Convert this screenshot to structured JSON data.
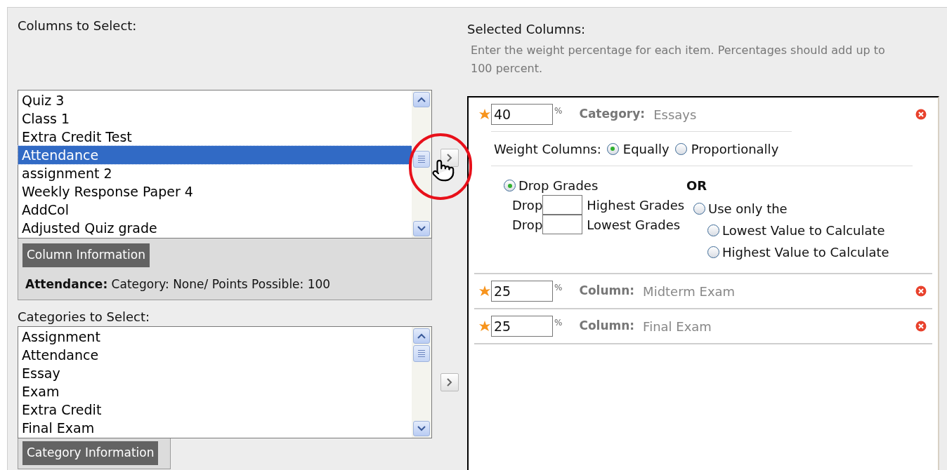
{
  "columns_to_select": {
    "label": "Columns to Select:",
    "items": [
      {
        "label": "Quiz 3",
        "selected": false
      },
      {
        "label": "Class 1",
        "selected": false
      },
      {
        "label": "Extra Credit Test",
        "selected": false
      },
      {
        "label": "Attendance",
        "selected": true
      },
      {
        "label": "assignment 2",
        "selected": false
      },
      {
        "label": "Weekly Response Paper 4",
        "selected": false
      },
      {
        "label": "AddCol",
        "selected": false
      },
      {
        "label": "Adjusted Quiz grade",
        "selected": false
      }
    ],
    "info_button": "Column Information",
    "info": "**Attendance:** Category: None/ Points Possible: 100"
  },
  "categories_to_select": {
    "label": "Categories to Select:",
    "items": [
      {
        "label": "Assignment",
        "selected": false
      },
      {
        "label": "Attendance",
        "selected": false
      },
      {
        "label": "Essay",
        "selected": false
      },
      {
        "label": "Exam",
        "selected": false
      },
      {
        "label": "Extra Credit",
        "selected": false
      },
      {
        "label": "Final Exam",
        "selected": false
      }
    ],
    "info_button": "Category Information"
  },
  "selected_columns": {
    "label": "Selected Columns:",
    "hint": "Enter the weight percentage for each item. Percentages should add up to 100 percent.",
    "entries": [
      {
        "weight": "40",
        "unit": "%",
        "type_label": "Category:",
        "name": "Essays",
        "weight_columns": {
          "label": "Weight Columns:",
          "options": [
            {
              "label": "Equally",
              "selected": true
            },
            {
              "label": "Proportionally",
              "selected": false
            }
          ]
        },
        "drop_grades": {
          "label": "Drop Grades",
          "selected": true,
          "rows": [
            {
              "prefix": "Drop",
              "suffix": "Highest Grades"
            },
            {
              "prefix": "Drop",
              "suffix": "Lowest Grades"
            }
          ],
          "or": "OR",
          "use_only": {
            "label": "Use only the",
            "selected": false,
            "options": [
              {
                "label": "Lowest Value to Calculate",
                "selected": false
              },
              {
                "label": "Highest Value to Calculate",
                "selected": false
              }
            ]
          }
        }
      },
      {
        "weight": "25",
        "unit": "%",
        "type_label": "Column:",
        "name": "Midterm Exam"
      },
      {
        "weight": "25",
        "unit": "%",
        "type_label": "Column:",
        "name": "Final Exam"
      }
    ]
  }
}
